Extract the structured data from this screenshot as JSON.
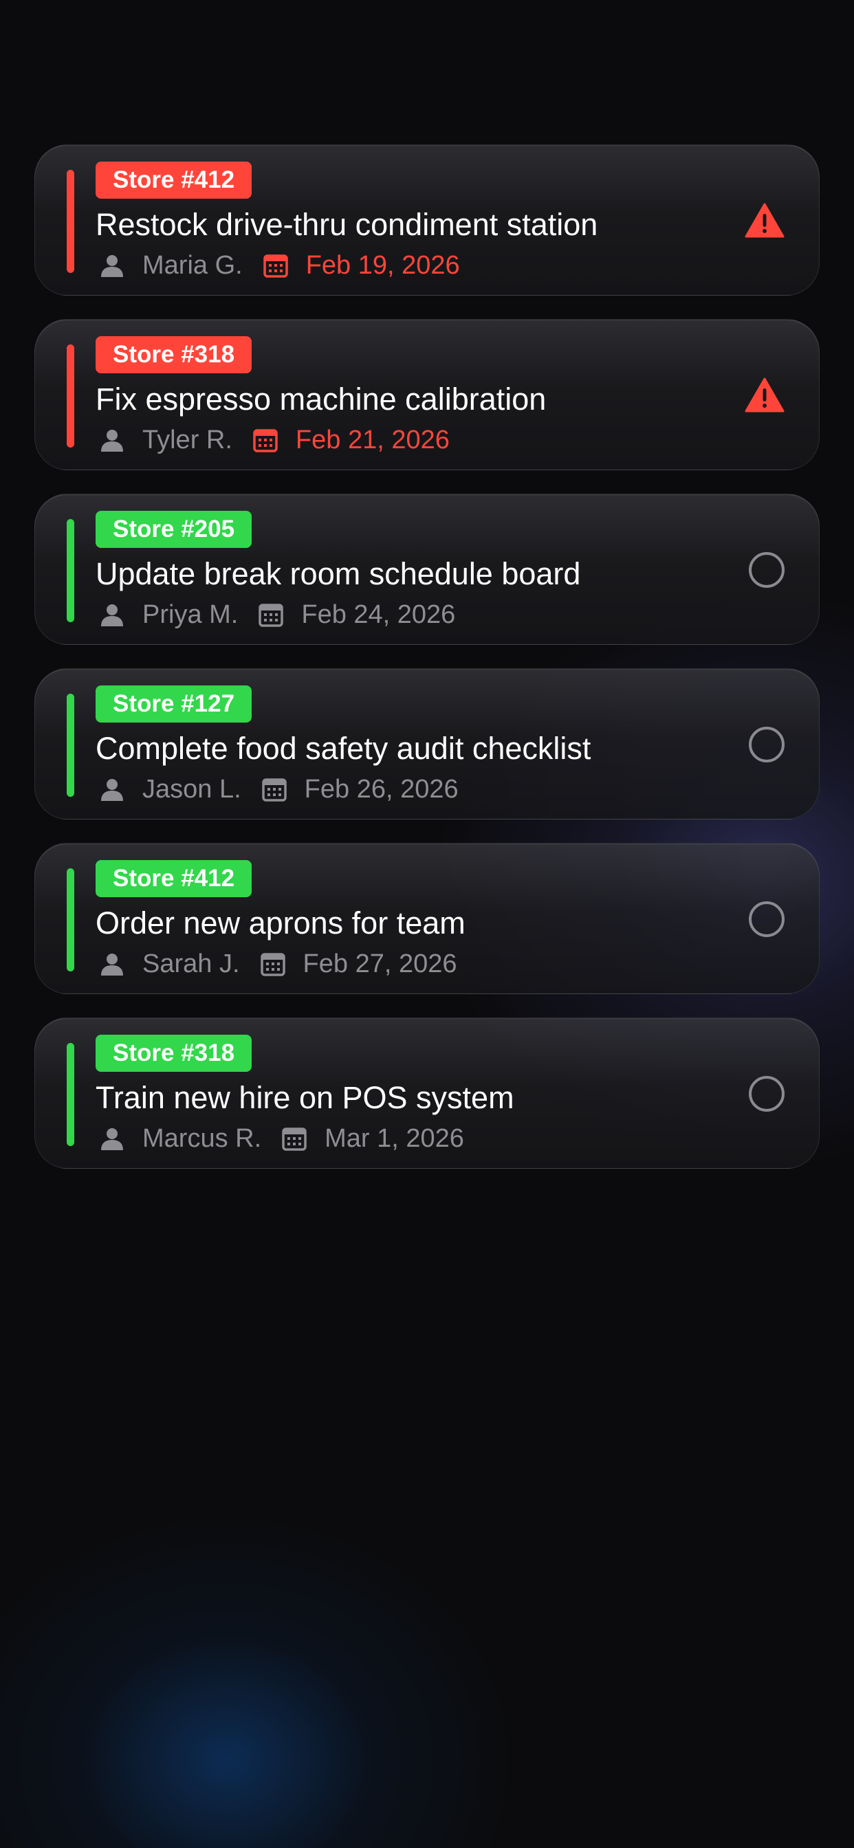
{
  "colors": {
    "overdue": "#ff453a",
    "ok": "#32d74b",
    "secondary_text": "#8e8e93",
    "background": "#0b0b0d"
  },
  "icons": {
    "assignee": "person-icon",
    "due": "calendar-icon",
    "overdue_marker": "warning-triangle-icon",
    "incomplete_marker": "empty-circle-icon"
  },
  "tasks": [
    {
      "store": "Store #412",
      "title": "Restock drive-thru condiment station",
      "assignee": "Maria G.",
      "due": "Feb 19, 2026",
      "status": "overdue"
    },
    {
      "store": "Store #318",
      "title": "Fix espresso machine calibration",
      "assignee": "Tyler R.",
      "due": "Feb 21, 2026",
      "status": "overdue"
    },
    {
      "store": "Store #205",
      "title": "Update break room schedule board",
      "assignee": "Priya M.",
      "due": "Feb 24, 2026",
      "status": "ok"
    },
    {
      "store": "Store #127",
      "title": "Complete food safety audit checklist",
      "assignee": "Jason L.",
      "due": "Feb 26, 2026",
      "status": "ok"
    },
    {
      "store": "Store #412",
      "title": "Order new aprons for team",
      "assignee": "Sarah J.",
      "due": "Feb 27, 2026",
      "status": "ok"
    },
    {
      "store": "Store #318",
      "title": "Train new hire on POS system",
      "assignee": "Marcus R.",
      "due": "Mar 1, 2026",
      "status": "ok"
    }
  ]
}
